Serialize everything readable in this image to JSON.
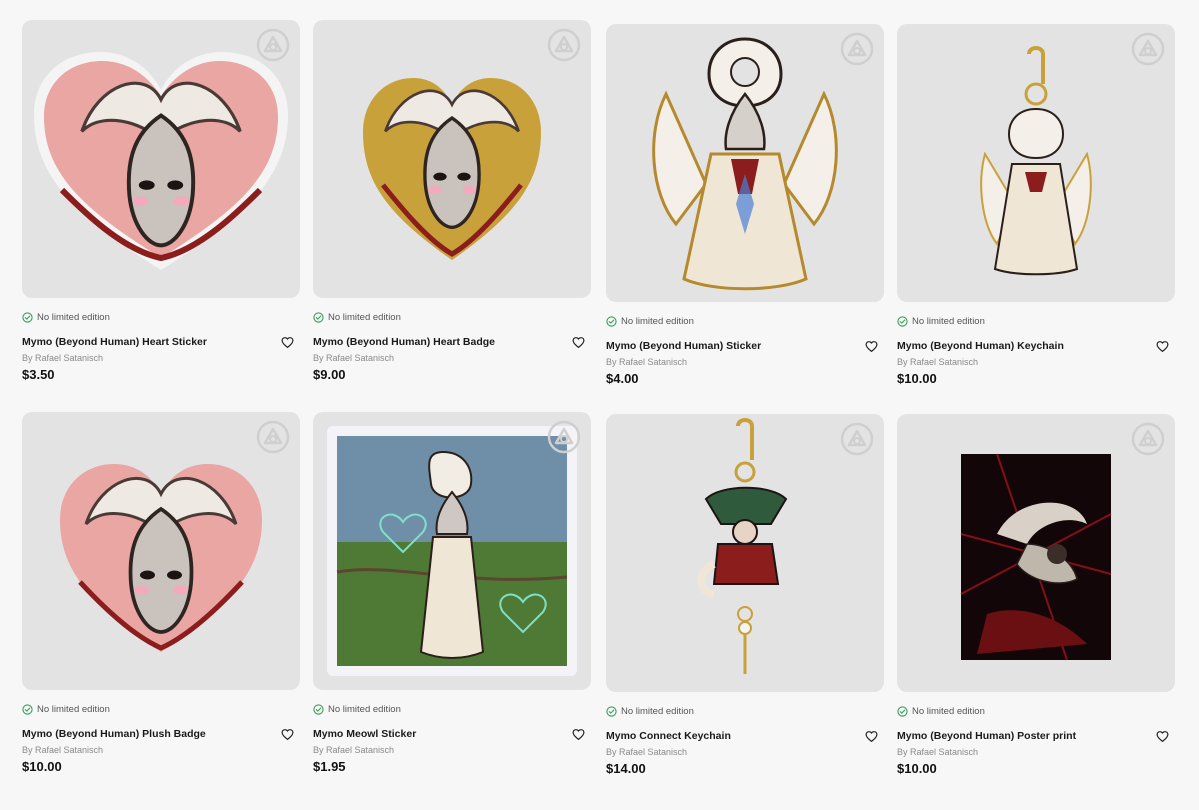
{
  "products": [
    {
      "edition": "No limited edition",
      "title": "Mymo (Beyond Human) Heart Sticker",
      "artist": "By Rafael Satanisch",
      "price": "$3.50",
      "icon": "heart-sticker-art"
    },
    {
      "edition": "No limited edition",
      "title": "Mymo (Beyond Human) Heart Badge",
      "artist": "By Rafael Satanisch",
      "price": "$9.00",
      "icon": "heart-badge-art"
    },
    {
      "edition": "No limited edition",
      "title": "Mymo (Beyond Human) Sticker",
      "artist": "By Rafael Satanisch",
      "price": "$4.00",
      "icon": "sticker-art"
    },
    {
      "edition": "No limited edition",
      "title": "Mymo (Beyond Human) Keychain",
      "artist": "By Rafael Satanisch",
      "price": "$10.00",
      "icon": "keychain-art"
    },
    {
      "edition": "No limited edition",
      "title": "Mymo (Beyond Human) Plush Badge",
      "artist": "By Rafael Satanisch",
      "price": "$10.00",
      "icon": "plush-badge-art"
    },
    {
      "edition": "No limited edition",
      "title": "Mymo Meowl Sticker",
      "artist": "By Rafael Satanisch",
      "price": "$1.95",
      "icon": "meowl-sticker-art"
    },
    {
      "edition": "No limited edition",
      "title": "Mymo Connect Keychain",
      "artist": "By Rafael Satanisch",
      "price": "$14.00",
      "icon": "connect-keychain-art"
    },
    {
      "edition": "No limited edition",
      "title": "Mymo (Beyond Human) Poster print",
      "artist": "By Rafael Satanisch",
      "price": "$10.00",
      "icon": "poster-art"
    }
  ]
}
